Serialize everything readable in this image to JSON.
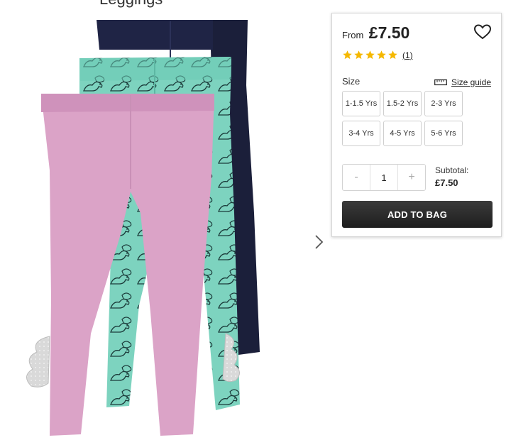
{
  "header": {
    "cropped_title": "Leggings"
  },
  "product": {
    "from_label": "From",
    "price": "£7.50",
    "rating": 5,
    "review_count": "(1)"
  },
  "icons": {
    "wishlist": "heart-icon",
    "next": "chevron-right-icon",
    "size_guide": "ruler-icon",
    "star": "star-icon"
  },
  "colors": {
    "star": "#f5b800",
    "button": "#262626"
  },
  "size": {
    "label": "Size",
    "guide_label": "Size guide",
    "options": [
      "1-1.5 Yrs",
      "1.5-2 Yrs",
      "2-3 Yrs",
      "3-4 Yrs",
      "4-5 Yrs",
      "5-6 Yrs"
    ]
  },
  "quantity": {
    "minus": "-",
    "value": "1",
    "plus": "+"
  },
  "subtotal": {
    "label": "Subtotal:",
    "value": "£7.50"
  },
  "cta": {
    "add_to_bag": "ADD TO BAG"
  }
}
